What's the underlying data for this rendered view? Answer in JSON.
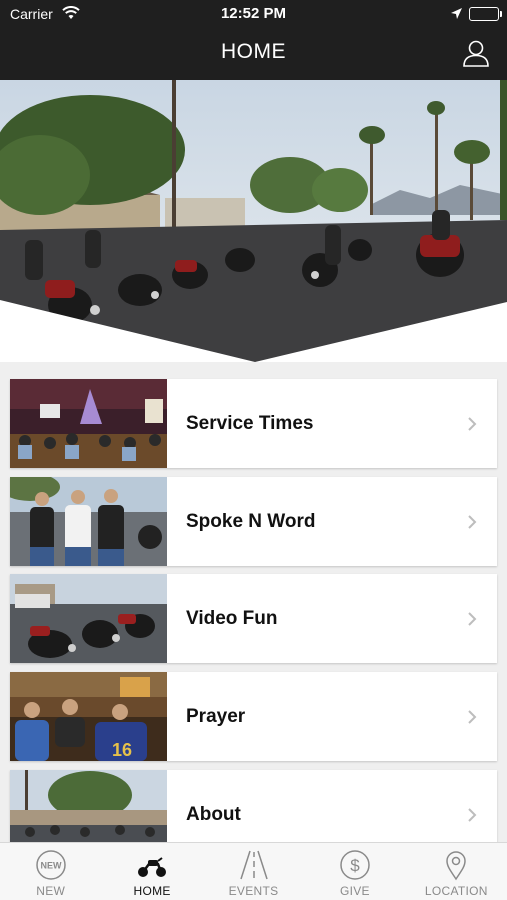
{
  "status_bar": {
    "carrier": "Carrier",
    "time": "12:52 PM"
  },
  "header": {
    "title": "HOME"
  },
  "menu": {
    "items": [
      {
        "label": "Service Times"
      },
      {
        "label": "Spoke N Word"
      },
      {
        "label": "Video Fun"
      },
      {
        "label": "Prayer"
      },
      {
        "label": "About"
      }
    ]
  },
  "tabbar": {
    "tabs": [
      {
        "label": "NEW",
        "icon": "new-badge-icon",
        "active": false
      },
      {
        "label": "HOME",
        "icon": "motorcycle-icon",
        "active": true
      },
      {
        "label": "EVENTS",
        "icon": "road-icon",
        "active": false
      },
      {
        "label": "GIVE",
        "icon": "dollar-icon",
        "active": false
      },
      {
        "label": "LOCATION",
        "icon": "location-pin-icon",
        "active": false
      }
    ],
    "new_badge_text": "NEW"
  },
  "colors": {
    "bar": "#1f1f1f",
    "background": "#efefef",
    "card": "#ffffff",
    "active_tab": "#111111",
    "inactive_tab": "#8a8a8a"
  }
}
